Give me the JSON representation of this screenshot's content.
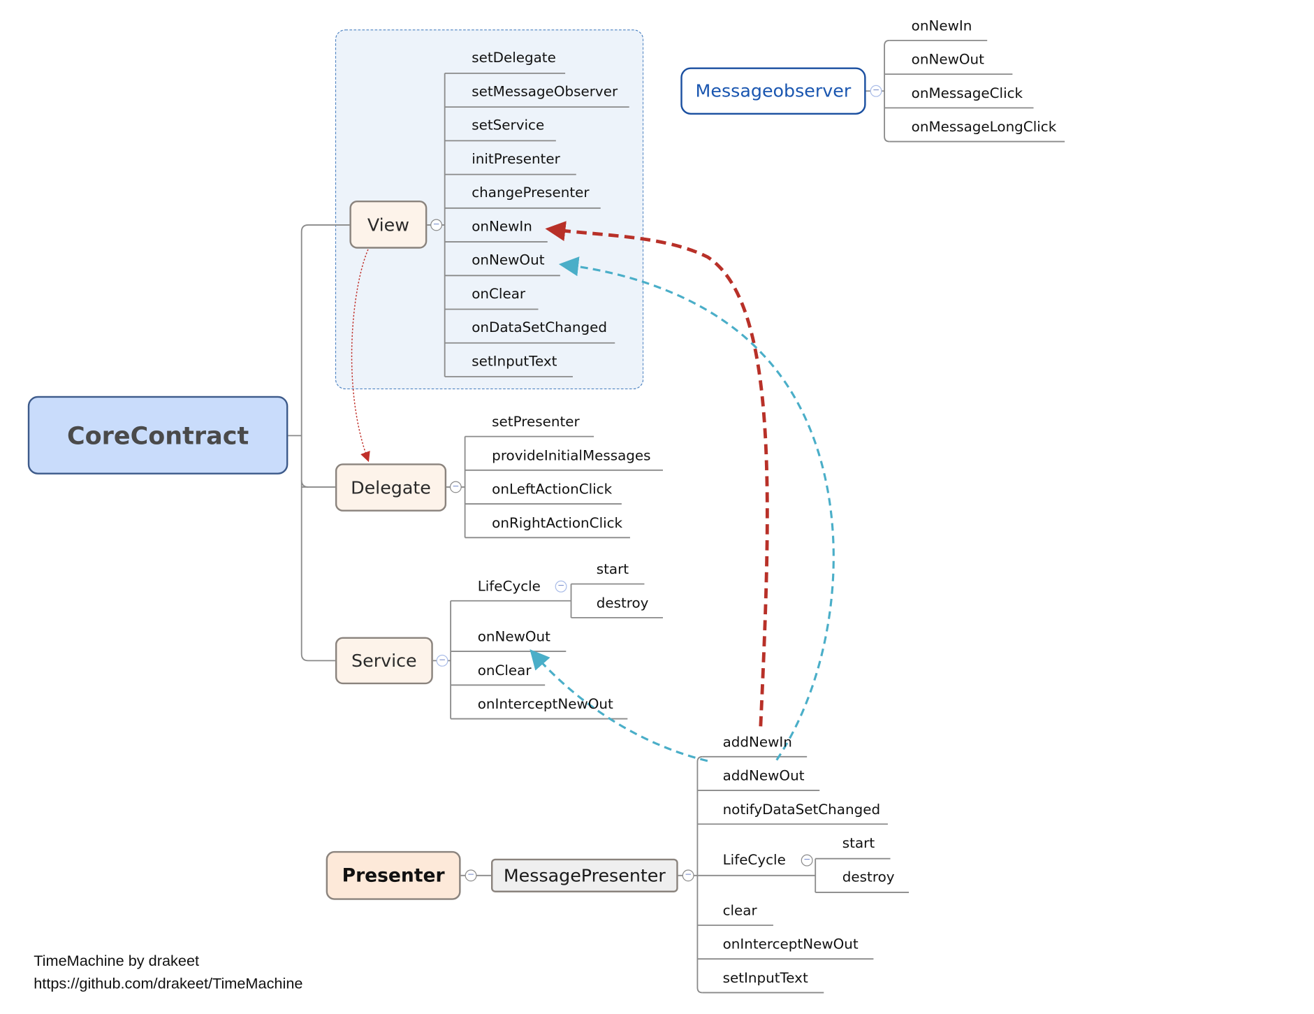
{
  "root": {
    "label": "CoreContract"
  },
  "view": {
    "label": "View",
    "methods": [
      "setDelegate",
      "setMessageObserver",
      "setService",
      "initPresenter",
      "changePresenter",
      "onNewIn",
      "onNewOut",
      "onClear",
      "onDataSetChanged",
      "setInputText"
    ]
  },
  "delegate": {
    "label": "Delegate",
    "methods": [
      "setPresenter",
      "provideInitialMessages",
      "onLeftActionClick",
      "onRightActionClick"
    ]
  },
  "service": {
    "label": "Service",
    "lifecycle": {
      "label": "LifeCycle",
      "children": [
        "start",
        "destroy"
      ]
    },
    "methods": [
      "onNewOut",
      "onClear",
      "onInterceptNewOut"
    ]
  },
  "messageobserver": {
    "label": "Messageobserver",
    "methods": [
      "onNewIn",
      "onNewOut",
      "onMessageClick",
      "onMessageLongClick"
    ]
  },
  "presenter": {
    "label": "Presenter",
    "impl": {
      "label": "MessagePresenter",
      "methods_before": [
        "addNewIn",
        "addNewOut",
        "notifyDataSetChanged"
      ],
      "lifecycle": {
        "label": "LifeCycle",
        "children": [
          "start",
          "destroy"
        ]
      },
      "methods_after": [
        "clear",
        "onInterceptNewOut",
        "setInputText"
      ]
    }
  },
  "relationships": [
    {
      "from": "MessagePresenter.addNewIn",
      "to": "View.onNewIn",
      "style": "dashed",
      "color": "#b83028"
    },
    {
      "from": "MessagePresenter.addNewOut",
      "to": "View.onNewOut",
      "style": "dashed",
      "color": "#4aaec8"
    },
    {
      "from": "MessagePresenter.addNewOut",
      "to": "Service.onNewOut",
      "style": "dashed",
      "color": "#4aaec8"
    },
    {
      "from": "View",
      "to": "Delegate",
      "style": "dotted",
      "color": "#c0302a"
    }
  ],
  "collapse_symbol": "−",
  "footer": {
    "line1": "TimeMachine by drakeet",
    "line2": "https://github.com/drakeet/TimeMachine"
  }
}
